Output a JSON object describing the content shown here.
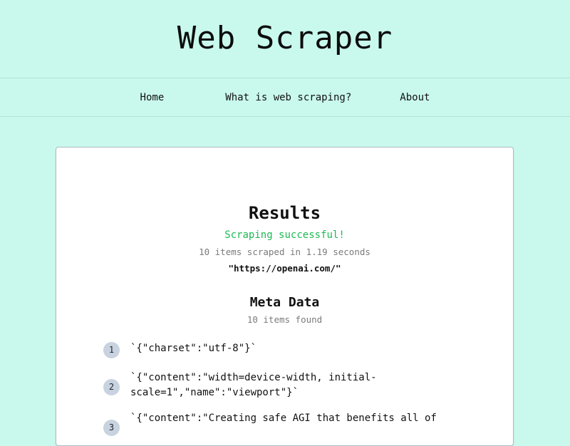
{
  "header": {
    "title": "Web Scraper"
  },
  "nav": {
    "items": [
      {
        "label": "Home"
      },
      {
        "label": "What is web scraping?"
      },
      {
        "label": "About"
      }
    ]
  },
  "results": {
    "title": "Results",
    "status": "Scraping successful!",
    "summary": "10 items scraped in 1.19 seconds",
    "url": "\"https://openai.com/\""
  },
  "meta": {
    "title": "Meta Data",
    "count": "10 items found",
    "items": [
      {
        "number": "1",
        "text": "`{\"charset\":\"utf-8\"}`"
      },
      {
        "number": "2",
        "text": "`{\"content\":\"width=device-width, initial-scale=1\",\"name\":\"viewport\"}`"
      },
      {
        "number": "3",
        "text": "`{\"content\":\"Creating safe AGI that benefits all of"
      }
    ]
  },
  "colors": {
    "background": "#c9f9ed",
    "success": "#1db954",
    "muted": "#7b7b7b",
    "badge": "#c8d3df"
  }
}
